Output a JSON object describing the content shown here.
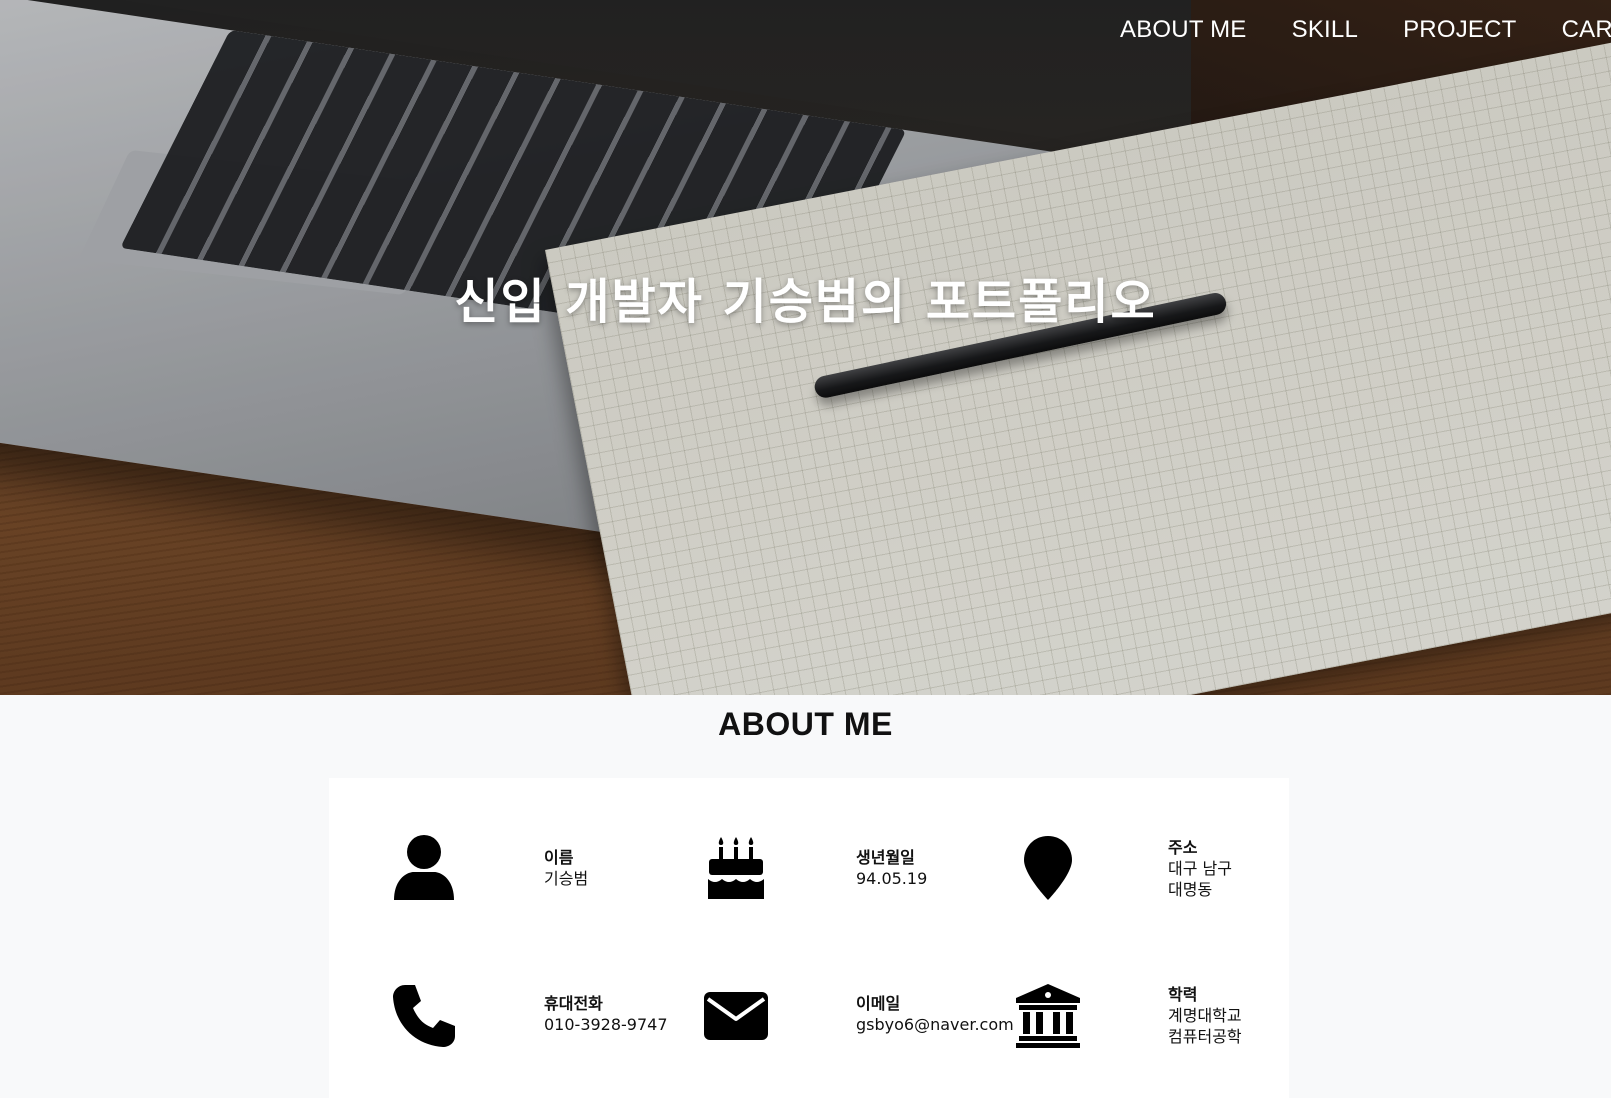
{
  "nav": {
    "items": [
      {
        "label": "ABOUT ME"
      },
      {
        "label": "SKILL"
      },
      {
        "label": "PROJECT"
      },
      {
        "label": "CAREER"
      }
    ]
  },
  "hero": {
    "title": "신입 개발자 기승범의 포트폴리오"
  },
  "about": {
    "heading": "ABOUT ME",
    "items": [
      {
        "icon": "user-icon",
        "label": "이름",
        "value": "기승범"
      },
      {
        "icon": "birthday-cake-icon",
        "label": "생년월일",
        "value": "94.05.19"
      },
      {
        "icon": "map-marker-icon",
        "label": "주소",
        "value": "대구 남구\n대명동"
      },
      {
        "icon": "phone-icon",
        "label": "휴대전화",
        "value": "010-3928-9747"
      },
      {
        "icon": "envelope-icon",
        "label": "이메일",
        "value": "gsbyo6@naver.com"
      },
      {
        "icon": "university-icon",
        "label": "학력",
        "value": "계명대학교\n컴퓨터공학"
      }
    ]
  }
}
